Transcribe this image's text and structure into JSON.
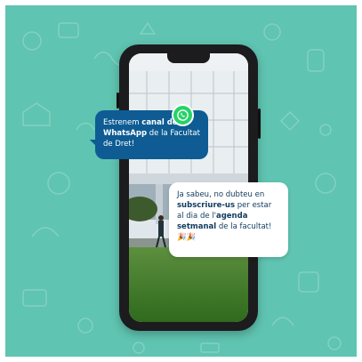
{
  "colors": {
    "background": "#5fc4b1",
    "phone": "#1c1c1e",
    "bubble_left": "#0e5c93",
    "bubble_right": "#ffffff",
    "text_dark": "#0f3a5e",
    "whatsapp": "#25d366"
  },
  "icons": {
    "logo": "whatsapp-icon",
    "emoji": "party-emoji-icon"
  },
  "bubble_left": {
    "p1": "Estrenem ",
    "p2": "canal de",
    "p3": "WhatsApp",
    "p4": " de la Facultat de Dret!"
  },
  "bubble_right": {
    "p1": "Ja sabeu, no dubteu en ",
    "p2": "subscriure-us",
    "p3": " per estar al dia de l'",
    "p4": "agenda setmanal",
    "p5": " de la facultat! 🎉🎉"
  }
}
